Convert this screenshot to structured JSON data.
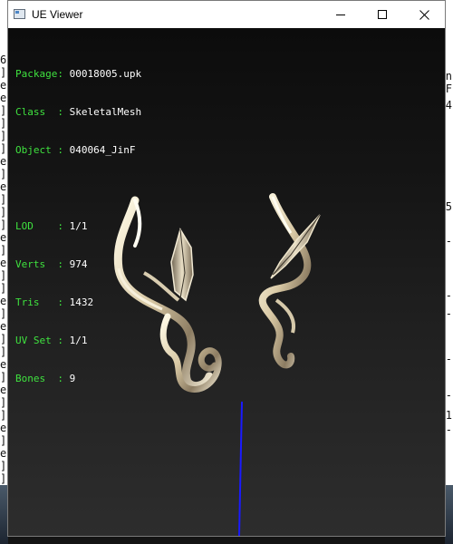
{
  "window": {
    "title": "UE Viewer"
  },
  "titlebar_buttons": {
    "minimize_icon": "minimize-icon",
    "maximize_icon": "maximize-icon",
    "close_icon": "close-icon"
  },
  "info": {
    "package_label": "Package:",
    "package_value": "00018005.upk",
    "class_label": "Class  :",
    "class_value": "SkeletalMesh",
    "object_label": "Object :",
    "object_value": "040064_JinF",
    "lod_label": "LOD    :",
    "lod_value": "1/1",
    "verts_label": "Verts  :",
    "verts_value": "974",
    "tris_label": "Tris   :",
    "tris_value": "1432",
    "uvset_label": "UV Set :",
    "uvset_value": "1/1",
    "bones_label": "Bones  :",
    "bones_value": "9"
  },
  "background_left_chars": [
    "6",
    "]",
    "e",
    "e",
    "]",
    "]",
    "]",
    "]",
    "e",
    "]",
    "e",
    "]",
    "]",
    "]",
    "e",
    "]",
    "e",
    "]",
    "]",
    "e",
    "]",
    "e",
    "]",
    "]",
    "e",
    "]",
    "e",
    "]",
    "]",
    "e",
    "]",
    "e",
    "]",
    "]",
    "]"
  ],
  "background_right_chars": [
    "n",
    "F",
    "4",
    "5",
    "-",
    "-",
    "-",
    "-",
    "-",
    "1",
    "-"
  ],
  "colors": {
    "label_green": "#3fe23f",
    "value_white": "#ffffff",
    "axis_blue": "#1a1aff"
  }
}
